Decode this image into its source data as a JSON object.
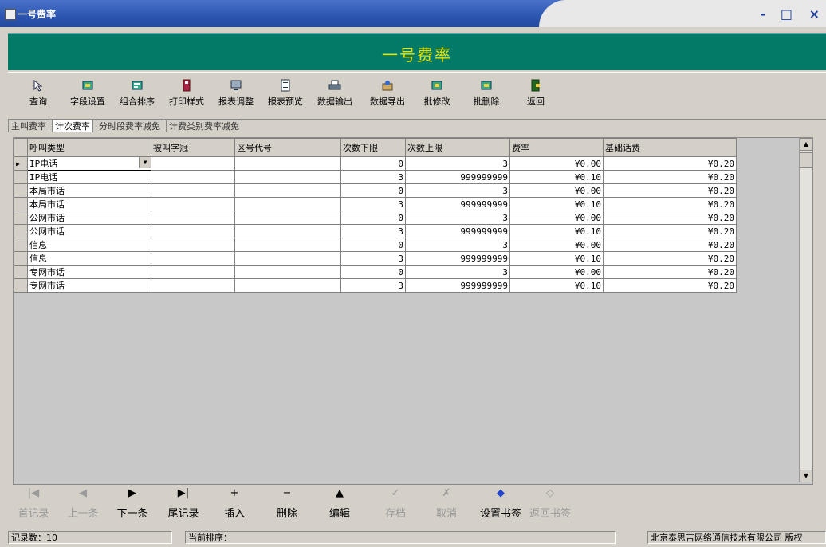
{
  "window": {
    "title": "一号费率",
    "min": "-",
    "max": "□",
    "close": "×"
  },
  "banner": {
    "title": "一号费率"
  },
  "toolbar": [
    {
      "label": "查询",
      "icon": "cursor-icon"
    },
    {
      "label": "字段设置",
      "icon": "field-settings-icon"
    },
    {
      "label": "组合排序",
      "icon": "sort-icon"
    },
    {
      "label": "打印样式",
      "icon": "print-style-icon"
    },
    {
      "label": "报表调整",
      "icon": "report-adjust-icon"
    },
    {
      "label": "报表预览",
      "icon": "report-preview-icon"
    },
    {
      "label": "数据输出",
      "icon": "printer-icon"
    },
    {
      "label": "数据导出",
      "icon": "export-icon"
    },
    {
      "label": "批修改",
      "icon": "batch-edit-icon"
    },
    {
      "label": "批删除",
      "icon": "batch-delete-icon"
    },
    {
      "label": "返回",
      "icon": "exit-icon"
    }
  ],
  "tabs": [
    {
      "label": "主叫费率"
    },
    {
      "label": "计次费率"
    },
    {
      "label": "分时段费率减免"
    },
    {
      "label": "计费类别费率减免"
    }
  ],
  "grid": {
    "columns": [
      "呼叫类型",
      "被叫字冠",
      "区号代号",
      "次数下限",
      "次数上限",
      "费率",
      "基础话费"
    ],
    "rows": [
      [
        "IP电话",
        "",
        "",
        "0",
        "3",
        "¥0.00",
        "¥0.20"
      ],
      [
        "IP电话",
        "",
        "",
        "3",
        "999999999",
        "¥0.10",
        "¥0.20"
      ],
      [
        "本局市话",
        "",
        "",
        "0",
        "3",
        "¥0.00",
        "¥0.20"
      ],
      [
        "本局市话",
        "",
        "",
        "3",
        "999999999",
        "¥0.10",
        "¥0.20"
      ],
      [
        "公网市话",
        "",
        "",
        "0",
        "3",
        "¥0.00",
        "¥0.20"
      ],
      [
        "公网市话",
        "",
        "",
        "3",
        "999999999",
        "¥0.10",
        "¥0.20"
      ],
      [
        "信息",
        "",
        "",
        "0",
        "3",
        "¥0.00",
        "¥0.20"
      ],
      [
        "信息",
        "",
        "",
        "3",
        "999999999",
        "¥0.10",
        "¥0.20"
      ],
      [
        "专网市话",
        "",
        "",
        "0",
        "3",
        "¥0.00",
        "¥0.20"
      ],
      [
        "专网市话",
        "",
        "",
        "3",
        "999999999",
        "¥0.10",
        "¥0.20"
      ]
    ]
  },
  "navbar": [
    {
      "label": "首记录",
      "icon": "first-record-icon",
      "glyph": "|◀",
      "enabled": false
    },
    {
      "label": "上一条",
      "icon": "prev-record-icon",
      "glyph": "◀",
      "enabled": false
    },
    {
      "label": "下一条",
      "icon": "next-record-icon",
      "glyph": "▶",
      "enabled": true
    },
    {
      "label": "尾记录",
      "icon": "last-record-icon",
      "glyph": "▶|",
      "enabled": true
    },
    {
      "label": "插入",
      "icon": "plus-icon",
      "glyph": "+",
      "enabled": true
    },
    {
      "label": "删除",
      "icon": "minus-icon",
      "glyph": "−",
      "enabled": true
    },
    {
      "label": "编辑",
      "icon": "edit-triangle-icon",
      "glyph": "▲",
      "enabled": true
    },
    {
      "label": "存档",
      "icon": "save-check-icon",
      "glyph": "✓",
      "enabled": false
    },
    {
      "label": "取消",
      "icon": "cancel-icon",
      "glyph": "✗",
      "enabled": false
    },
    {
      "label": "设置书签",
      "icon": "set-bookmark-icon",
      "glyph": "◆",
      "enabled": true
    },
    {
      "label": "返回书签",
      "icon": "goto-bookmark-icon",
      "glyph": "◇",
      "enabled": false
    }
  ],
  "status": {
    "record_count": "记录数：10",
    "sort_order": "当前排序：",
    "company": "北京泰思吉网络通信技术有限公司 版权"
  }
}
